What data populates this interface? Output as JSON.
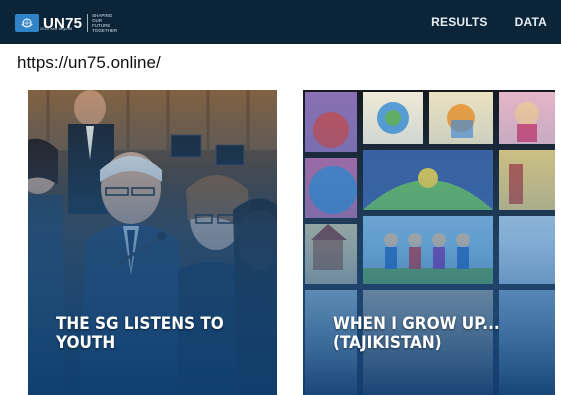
{
  "header": {
    "logo_text": "UN75",
    "tagline": "Shaping our future together",
    "subbrand": "2020 and beyond",
    "nav": [
      "RESULTS",
      "DATA"
    ]
  },
  "url_text": "https://un75.online/",
  "cards": [
    {
      "title_line1": "THE SG LISTENS TO",
      "title_line2": "YOUTH"
    },
    {
      "title_line1": "WHEN I GROW UP...",
      "title_line2": "(TAJIKISTAN)"
    }
  ],
  "colors": {
    "header_bg": "#0c2438",
    "un_blue": "#2f83c6"
  }
}
